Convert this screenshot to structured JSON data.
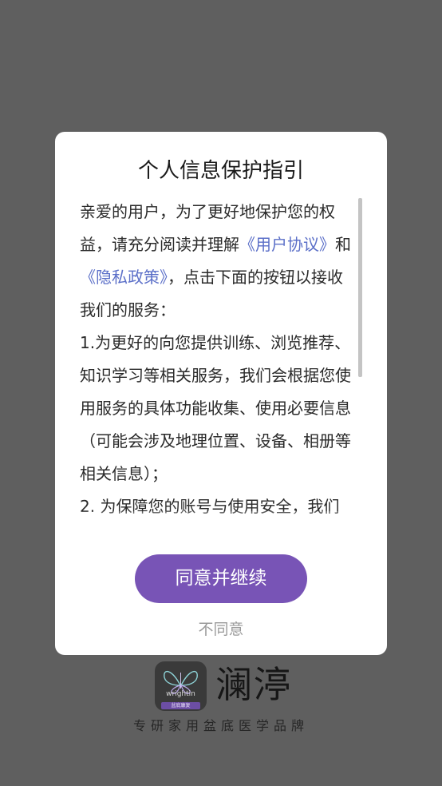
{
  "dialog": {
    "title": "个人信息保护指引",
    "body": {
      "intro_before_link1": "亲爱的用户，为了更好地保护您的权益，请充分阅读并理解",
      "link_user_agreement": "《用户协议》",
      "connector": "和",
      "link_privacy_policy": "《隐私政策》",
      "intro_after_links": "，点击下面的按钮以接收我们的服务：",
      "item1": "1.为更好的向您提供训练、浏览推荐、知识学习等相关服务，我们会根据您使用服务的具体功能收集、使用必要信息（可能会涉及地理位置、设备、相册等相关信息）；",
      "item2": "2. 为保障您的账号与使用安全，我们"
    },
    "agree_label": "同意并继续",
    "disagree_label": "不同意"
  },
  "brand": {
    "name": "澜渟",
    "logo_text": "wrightin",
    "logo_sub": "盆底康复",
    "slogan": "专研家用盆底医学品牌"
  },
  "colors": {
    "accent": "#7854b6",
    "link": "#5b6fc8",
    "overlay": "#5f5f5f"
  }
}
